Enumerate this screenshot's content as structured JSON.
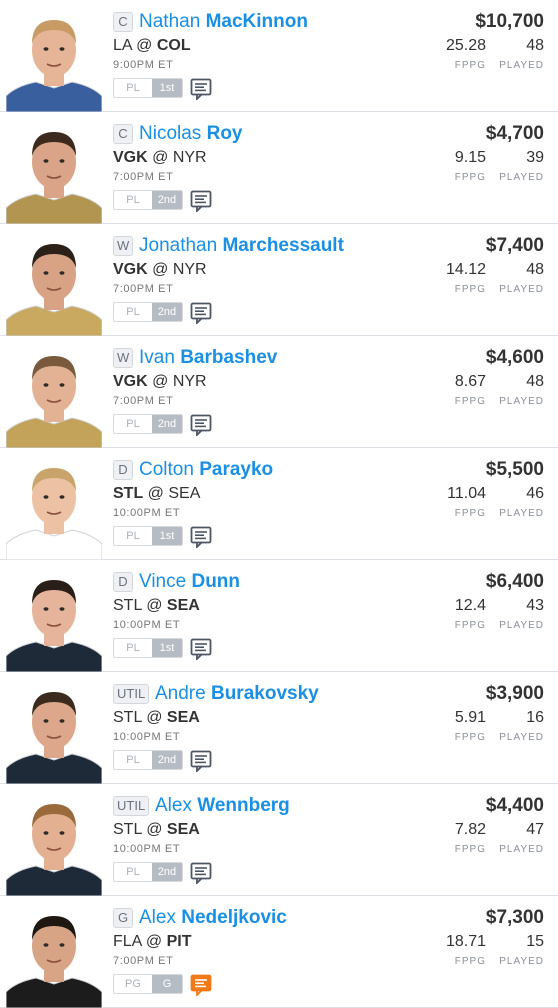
{
  "labels": {
    "fppg": "FPPG",
    "played": "PLAYED"
  },
  "players": [
    {
      "pos": "C",
      "first": "Nathan",
      "last": "MacKinnon",
      "away": "LA",
      "sep": "@",
      "home": "COL",
      "bold_side": "home",
      "time": "9:00PM ET",
      "salary": "$10,700",
      "fppg": "25.28",
      "played": "48",
      "tag1": "PL",
      "tag2": "1st",
      "note_color": "#4b5563",
      "jersey": "#3a5f9e",
      "skin": "#e6b597",
      "hair": "#c79b63"
    },
    {
      "pos": "C",
      "first": "Nicolas",
      "last": "Roy",
      "away": "VGK",
      "sep": "@",
      "home": "NYR",
      "bold_side": "away",
      "time": "7:00PM ET",
      "salary": "$4,700",
      "fppg": "9.15",
      "played": "39",
      "tag1": "PL",
      "tag2": "2nd",
      "note_color": "#4b5563",
      "jersey": "#b39552",
      "skin": "#d9a487",
      "hair": "#3d2a1e"
    },
    {
      "pos": "W",
      "first": "Jonathan",
      "last": "Marchessault",
      "away": "VGK",
      "sep": "@",
      "home": "NYR",
      "bold_side": "away",
      "time": "7:00PM ET",
      "salary": "$7,400",
      "fppg": "14.12",
      "played": "48",
      "tag1": "PL",
      "tag2": "2nd",
      "note_color": "#4b5563",
      "jersey": "#c9a860",
      "skin": "#d8a385",
      "hair": "#2c2119"
    },
    {
      "pos": "W",
      "first": "Ivan",
      "last": "Barbashev",
      "away": "VGK",
      "sep": "@",
      "home": "NYR",
      "bold_side": "away",
      "time": "7:00PM ET",
      "salary": "$4,600",
      "fppg": "8.67",
      "played": "48",
      "tag1": "PL",
      "tag2": "2nd",
      "note_color": "#4b5563",
      "jersey": "#c3a35a",
      "skin": "#e3b194",
      "hair": "#7a5a3c"
    },
    {
      "pos": "D",
      "first": "Colton",
      "last": "Parayko",
      "away": "STL",
      "sep": "@",
      "home": "SEA",
      "bold_side": "away",
      "time": "10:00PM ET",
      "salary": "$5,500",
      "fppg": "11.04",
      "played": "46",
      "tag1": "PL",
      "tag2": "1st",
      "note_color": "#4b5563",
      "jersey": "#ffffff",
      "skin": "#edc2a4",
      "hair": "#c9a46a"
    },
    {
      "pos": "D",
      "first": "Vince",
      "last": "Dunn",
      "away": "STL",
      "sep": "@",
      "home": "SEA",
      "bold_side": "home",
      "time": "10:00PM ET",
      "salary": "$6,400",
      "fppg": "12.4",
      "played": "43",
      "tag1": "PL",
      "tag2": "1st",
      "note_color": "#4b5563",
      "jersey": "#1f2a38",
      "skin": "#e5b49a",
      "hair": "#2a1f18"
    },
    {
      "pos": "UTIL",
      "first": "Andre",
      "last": "Burakovsky",
      "away": "STL",
      "sep": "@",
      "home": "SEA",
      "bold_side": "home",
      "time": "10:00PM ET",
      "salary": "$3,900",
      "fppg": "5.91",
      "played": "16",
      "tag1": "PL",
      "tag2": "2nd",
      "note_color": "#4b5563",
      "jersey": "#1f2a38",
      "skin": "#dca78a",
      "hair": "#3b2a1e"
    },
    {
      "pos": "UTIL",
      "first": "Alex",
      "last": "Wennberg",
      "away": "STL",
      "sep": "@",
      "home": "SEA",
      "bold_side": "home",
      "time": "10:00PM ET",
      "salary": "$4,400",
      "fppg": "7.82",
      "played": "47",
      "tag1": "PL",
      "tag2": "2nd",
      "note_color": "#4b5563",
      "jersey": "#1f2a38",
      "skin": "#e4b092",
      "hair": "#9a6a3c"
    },
    {
      "pos": "G",
      "first": "Alex",
      "last": "Nedeljkovic",
      "away": "FLA",
      "sep": "@",
      "home": "PIT",
      "bold_side": "home",
      "time": "7:00PM ET",
      "salary": "$7,300",
      "fppg": "18.71",
      "played": "15",
      "tag1": "PG",
      "tag2": "G",
      "note_color": "#f07a1a",
      "jersey": "#1c1c1c",
      "skin": "#d8a486",
      "hair": "#1e1712"
    }
  ]
}
